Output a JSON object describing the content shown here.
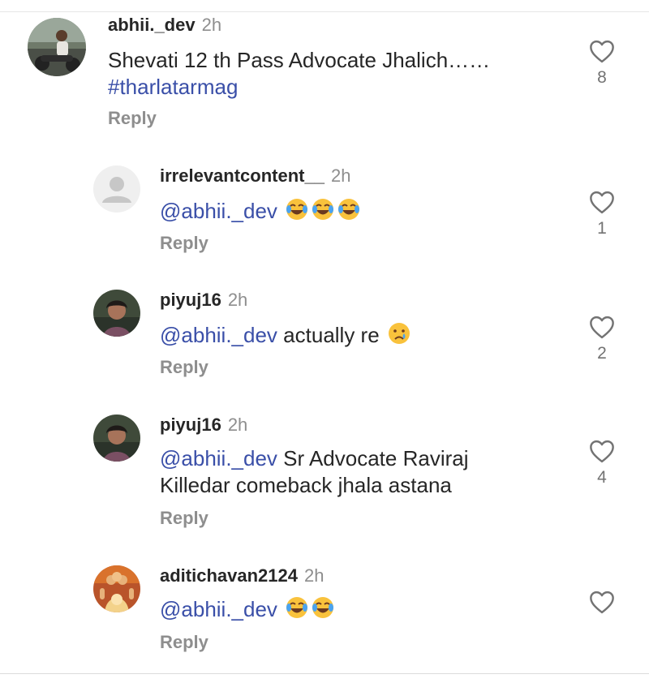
{
  "comments": [
    {
      "username": "abhii._dev",
      "time": "2h",
      "text": "Shevati 12 th Pass Advocate Jhalich……",
      "hashtag": "#tharlatarmag",
      "reply_label": "Reply",
      "likes": "8",
      "avatar": "photo-man-on-motorbike"
    },
    {
      "username": "irrelevantcontent__",
      "time": "2h",
      "mention": "@abhii._dev",
      "emojis": [
        "face-with-tears-of-joy",
        "face-with-tears-of-joy",
        "face-with-tears-of-joy"
      ],
      "reply_label": "Reply",
      "likes": "1",
      "avatar": "default-profile-silhouette"
    },
    {
      "username": "piyuj16",
      "time": "2h",
      "mention": "@abhii._dev",
      "text": "actually re",
      "emojis": [
        "crying-face"
      ],
      "reply_label": "Reply",
      "likes": "2",
      "avatar": "photo-woman"
    },
    {
      "username": "piyuj16",
      "time": "2h",
      "mention": "@abhii._dev",
      "text": "Sr Advocate Raviraj Killedar comeback jhala astana",
      "reply_label": "Reply",
      "likes": "4",
      "avatar": "photo-woman"
    },
    {
      "username": "aditichavan2124",
      "time": "2h",
      "mention": "@abhii._dev",
      "emojis": [
        "face-with-tears-of-joy",
        "face-with-tears-of-joy"
      ],
      "reply_label": "Reply",
      "likes": "",
      "avatar": "photo-deity-illustration"
    }
  ],
  "colors": {
    "mention": "#3a4fa8",
    "secondary_text": "#8e8e8e",
    "primary_text": "#262626"
  }
}
